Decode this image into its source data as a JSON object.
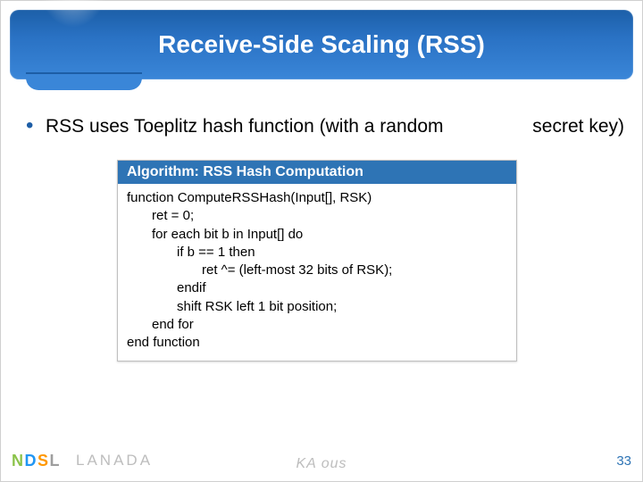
{
  "title": "Receive-Side Scaling (RSS)",
  "bullet": {
    "text_left": "RSS uses Toeplitz hash function (with a random",
    "text_right": "secret key)"
  },
  "algorithm": {
    "header": "Algorithm: RSS Hash Computation",
    "lines": {
      "l0": "function ComputeRSSHash(Input[], RSK)",
      "l1": "ret = 0;",
      "l2": "for each bit b in Input[] do",
      "l3": "if b == 1 then",
      "l4": "ret ^= (left-most 32 bits of RSK);",
      "l5": "endif",
      "l6": "shift RSK left 1 bit position;",
      "l7": "end for",
      "l8": "end function"
    }
  },
  "footer": {
    "ndsl": {
      "c1": "N",
      "c2": "D",
      "c3": "S",
      "c4": "L"
    },
    "lanada": "LANADA",
    "center": "KA ous",
    "page": "33"
  }
}
